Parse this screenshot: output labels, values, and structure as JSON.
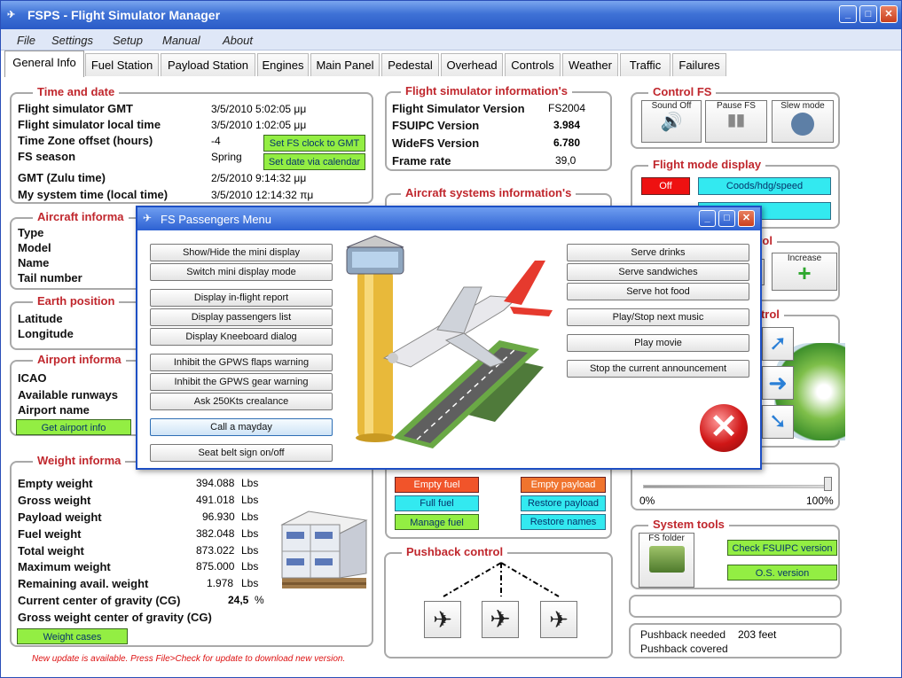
{
  "window": {
    "title": "FSPS - Flight Simulator Manager",
    "icon": "airplane-icon"
  },
  "menu": [
    "File",
    "Settings",
    "Setup",
    "Manual",
    "About"
  ],
  "tabs": [
    "General Info",
    "Fuel Station",
    "Payload Station",
    "Engines",
    "Main Panel",
    "Pedestal",
    "Overhead",
    "Controls",
    "Weather",
    "Traffic",
    "Failures"
  ],
  "time_date": {
    "title": "Time and date",
    "rows": [
      {
        "label": "Flight simulator GMT",
        "value": "3/5/2010 5:02:05 μμ"
      },
      {
        "label": "Flight simulator local time",
        "value": "3/5/2010 1:02:05 μμ"
      },
      {
        "label": "Time Zone offset (hours)",
        "value": "-4"
      },
      {
        "label": "FS season",
        "value": "Spring"
      },
      {
        "label": "GMT (Zulu time)",
        "value": "2/5/2010 9:14:32 μμ"
      },
      {
        "label": "My system time (local time)",
        "value": "3/5/2010 12:14:32 πμ"
      }
    ],
    "btn_clock": "Set FS clock to GMT",
    "btn_calendar": "Set date via calendar"
  },
  "aircraft_info": {
    "title": "Aircraft informa",
    "rows": [
      "Type",
      "Model",
      "Name",
      "Tail number"
    ]
  },
  "earth": {
    "title": "Earth position",
    "rows": [
      "Latitude",
      "Longitude"
    ]
  },
  "airport": {
    "title": "Airport informa",
    "rows": [
      "ICAO",
      "Available runways",
      "Airport name"
    ],
    "btn": "Get airport info"
  },
  "weight": {
    "title": "Weight informa",
    "rows": [
      {
        "label": "Empty weight",
        "value": "394.088",
        "unit": "Lbs"
      },
      {
        "label": "Gross weight",
        "value": "491.018",
        "unit": "Lbs"
      },
      {
        "label": "Payload weight",
        "value": "96.930",
        "unit": "Lbs"
      },
      {
        "label": "Fuel weight",
        "value": "382.048",
        "unit": "Lbs"
      },
      {
        "label": "Total weight",
        "value": "873.022",
        "unit": "Lbs"
      },
      {
        "label": "Maximum weight",
        "value": "875.000",
        "unit": "Lbs"
      },
      {
        "label": "Remaining avail. weight",
        "value": "1.978",
        "unit": "Lbs"
      },
      {
        "label": "Current center of gravity (CG)",
        "value": "24,5",
        "unit": "%"
      },
      {
        "label": "Gross weight center of gravity (CG)",
        "value": "",
        "unit": ""
      }
    ],
    "btn": "Weight cases"
  },
  "fs_info": {
    "title": "Flight simulator information's",
    "rows": [
      {
        "label": "Flight Simulator Version",
        "value": "FS2004"
      },
      {
        "label": "FSUIPC Version",
        "value": "3.984"
      },
      {
        "label": "WideFS  Version",
        "value": "6.780"
      },
      {
        "label": "Frame rate",
        "value": "39,0"
      }
    ]
  },
  "systems": {
    "title": "Aircraft systems information's"
  },
  "fuel_payload": {
    "empty_fuel": "Empty fuel",
    "empty_payload": "Empty payload",
    "full_fuel": "Full fuel",
    "restore_payload": "Restore payload",
    "manage_fuel": "Manage fuel",
    "restore_names": "Restore names"
  },
  "pushback": {
    "title": "Pushback control"
  },
  "control_fs": {
    "title": "Control FS",
    "sound": "Sound Off",
    "pause": "Pause FS",
    "slew": "Slew mode"
  },
  "flight_mode": {
    "title": "Flight mode display",
    "off": "Off",
    "coords": "Coods/hdg/speed"
  },
  "trol1": {
    "title": "trol",
    "increase": "Increase"
  },
  "trol2": {
    "title": "ntrol"
  },
  "slider": {
    "min": "0%",
    "max": "100%",
    "level": 1.0
  },
  "system_tools": {
    "title": "System tools",
    "folder": "FS folder",
    "fsuipc": "Check FSUIPC version",
    "os": "O.S. version"
  },
  "pushback_status": {
    "needed_label": "Pushback needed",
    "needed_value": "203 feet",
    "covered_label": "Pushback covered"
  },
  "update_note": "New update is available. Press File>Check for update to download new version.",
  "dialog": {
    "title": "FS Passengers Menu",
    "left": [
      "Show/Hide the mini display",
      "Switch mini display mode",
      "Display in-flight report",
      "Display passengers list",
      "Display Kneeboard dialog",
      "Inhibit the GPWS flaps warning",
      "Inhibit the GPWS gear warning",
      "Ask 250Kts crealance",
      "Call a mayday",
      "Seat belt sign on/off"
    ],
    "right": [
      "Serve drinks",
      "Serve sandwiches",
      "Serve hot food",
      "Play/Stop next music",
      "Play movie",
      "Stop the current announcement"
    ]
  }
}
